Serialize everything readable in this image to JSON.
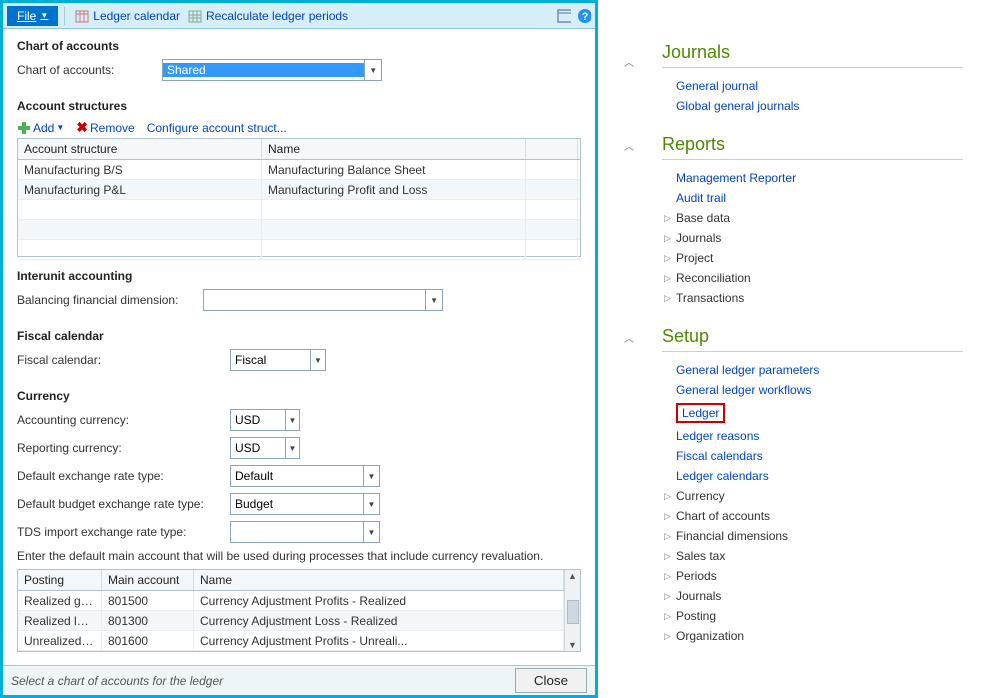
{
  "toolbar": {
    "file": "File",
    "ledger_calendar": "Ledger calendar",
    "recalc": "Recalculate ledger periods"
  },
  "chart": {
    "section": "Chart of accounts",
    "label": "Chart of accounts:",
    "value": "Shared"
  },
  "structures": {
    "section": "Account structures",
    "add": "Add",
    "remove": "Remove",
    "configure": "Configure account struct...",
    "headers": {
      "c1": "Account structure",
      "c2": "Name"
    },
    "rows": [
      {
        "c1": "Manufacturing B/S",
        "c2": "Manufacturing Balance Sheet"
      },
      {
        "c1": "Manufacturing P&L",
        "c2": "Manufacturing Profit and Loss"
      }
    ]
  },
  "interunit": {
    "section": "Interunit accounting",
    "label": "Balancing financial dimension:",
    "value": ""
  },
  "fiscal": {
    "section": "Fiscal calendar",
    "label": "Fiscal calendar:",
    "value": "Fiscal"
  },
  "currency": {
    "section": "Currency",
    "acct_label": "Accounting currency:",
    "acct_value": "USD",
    "rep_label": "Reporting currency:",
    "rep_value": "USD",
    "def_label": "Default exchange rate type:",
    "def_value": "Default",
    "bud_label": "Default budget exchange rate type:",
    "bud_value": "Budget",
    "tds_label": "TDS import exchange rate type:",
    "tds_value": "",
    "hint": "Enter the default main account that will be used during processes that include currency revaluation.",
    "grid_headers": {
      "c1": "Posting",
      "c2": "Main account",
      "c3": "Name"
    },
    "grid_rows": [
      {
        "c1": "Realized gain",
        "c2": "801500",
        "c3": "Currency Adjustment Profits - Realized"
      },
      {
        "c1": "Realized loss",
        "c2": "801300",
        "c3": "Currency Adjustment Loss - Realized"
      },
      {
        "c1": "Unrealized gain",
        "c2": "801600",
        "c3": "Currency Adjustment Profits - Unreali..."
      }
    ]
  },
  "status": {
    "text": "Select a chart of accounts for the ledger",
    "close": "Close"
  },
  "nav": {
    "journals": {
      "title": "Journals",
      "links": [
        "General journal",
        "Global general journals"
      ]
    },
    "reports": {
      "title": "Reports",
      "links": [
        "Management Reporter",
        "Audit trail"
      ],
      "expand": [
        "Base data",
        "Journals",
        "Project",
        "Reconciliation",
        "Transactions"
      ]
    },
    "setup": {
      "title": "Setup",
      "links": [
        "General ledger parameters",
        "General ledger workflows",
        "Ledger",
        "Ledger reasons",
        "Fiscal calendars",
        "Ledger calendars"
      ],
      "expand": [
        "Currency",
        "Chart of accounts",
        "Financial dimensions",
        "Sales tax",
        "Periods",
        "Journals",
        "Posting",
        "Organization"
      ]
    }
  }
}
